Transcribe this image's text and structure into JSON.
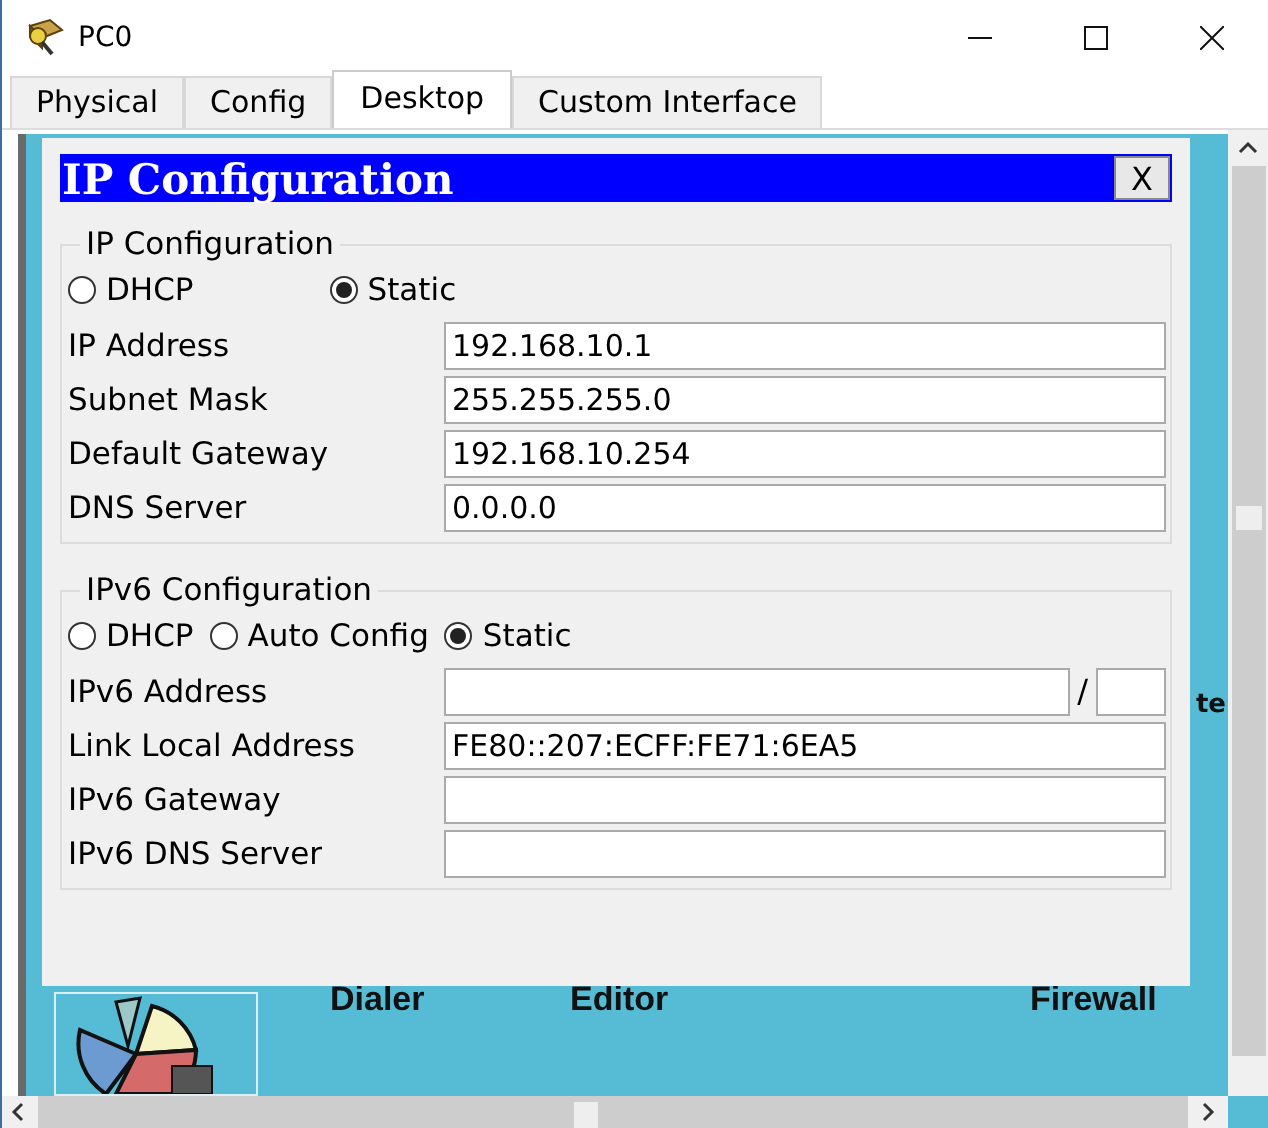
{
  "window": {
    "title": "PC0"
  },
  "tabs": [
    {
      "label": "Physical",
      "selected": false
    },
    {
      "label": "Config",
      "selected": false
    },
    {
      "label": "Desktop",
      "selected": true
    },
    {
      "label": "Custom Interface",
      "selected": false
    }
  ],
  "dialog": {
    "title": "IP Configuration",
    "close": "X",
    "groups": [
      {
        "title": "IP Configuration",
        "modes": [
          {
            "label": "DHCP",
            "selected": false
          },
          {
            "label": "Static",
            "selected": true
          }
        ],
        "fields": [
          {
            "label": "IP Address",
            "value": "192.168.10.1"
          },
          {
            "label": "Subnet Mask",
            "value": "255.255.255.0"
          },
          {
            "label": "Default Gateway",
            "value": "192.168.10.254"
          },
          {
            "label": "DNS Server",
            "value": "0.0.0.0"
          }
        ]
      },
      {
        "title": "IPv6 Configuration",
        "modes": [
          {
            "label": "DHCP",
            "selected": false
          },
          {
            "label": "Auto Config",
            "selected": false
          },
          {
            "label": "Static",
            "selected": true
          }
        ],
        "fields": [
          {
            "label": "IPv6 Address",
            "kind": "prefix",
            "separator": "/"
          },
          {
            "label": "Link Local Address",
            "value": "FE80::207:ECFF:FE71:6EA5"
          },
          {
            "label": "IPv6 Gateway"
          },
          {
            "label": "IPv6 DNS Server"
          }
        ]
      }
    ]
  },
  "desktop_apps": [
    {
      "label": "Dialer"
    },
    {
      "label": "Editor"
    },
    {
      "label": "Firewall"
    }
  ],
  "desktop_fragment": "te"
}
